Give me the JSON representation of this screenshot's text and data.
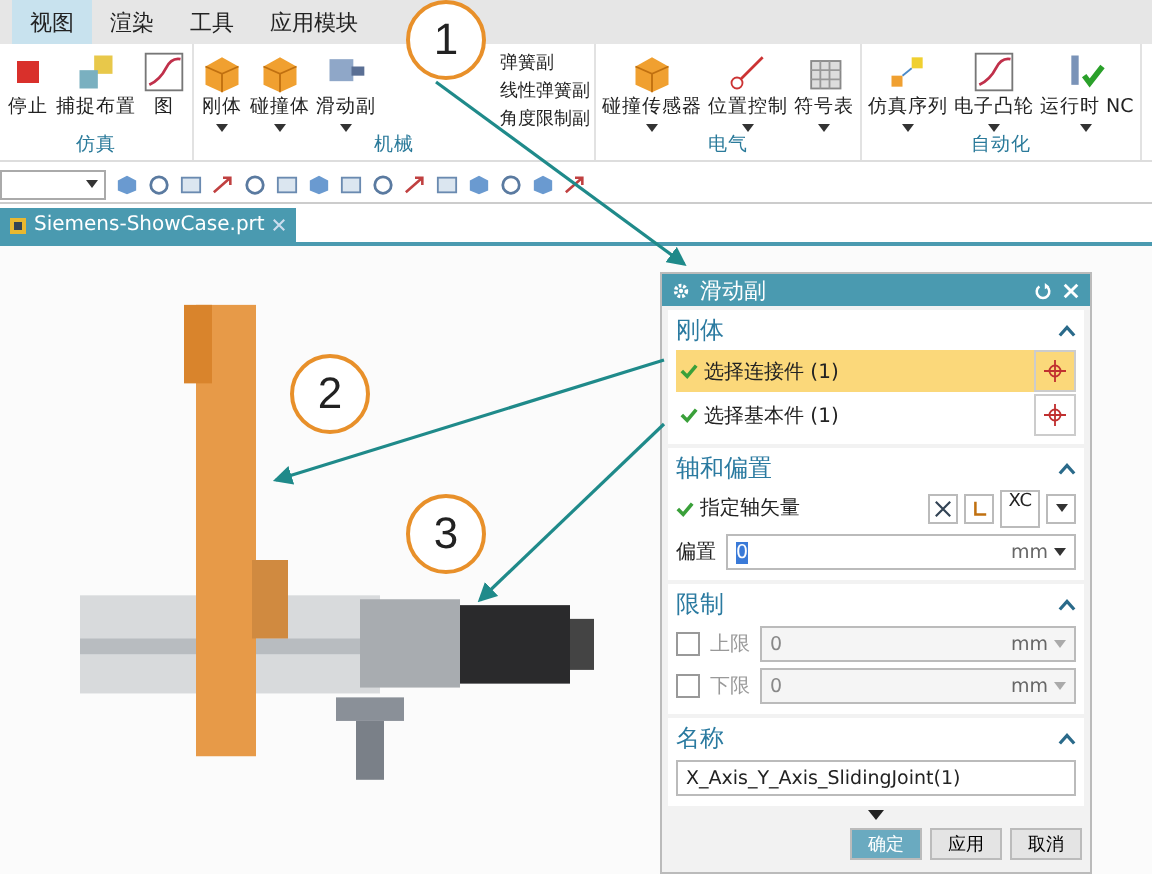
{
  "menu_tabs": [
    {
      "label": "视图",
      "selected": true
    },
    {
      "label": "渲染",
      "selected": false
    },
    {
      "label": "工具",
      "selected": false
    },
    {
      "label": "应用模块",
      "selected": false
    }
  ],
  "ribbon": {
    "groups": [
      {
        "label": "仿真",
        "buttons": [
          {
            "label": "停止",
            "has_menu": false
          },
          {
            "label": "捕捉布置",
            "has_menu": false
          },
          {
            "label": "图",
            "has_menu": false
          }
        ]
      },
      {
        "label": "机械",
        "buttons": [
          {
            "label": "刚体",
            "has_menu": true
          },
          {
            "label": "碰撞体",
            "has_menu": true
          },
          {
            "label": "滑动副",
            "has_menu": true
          }
        ],
        "small_items": [
          "弹簧副",
          "线性弹簧副",
          "角度限制副"
        ]
      },
      {
        "label": "电气",
        "buttons": [
          {
            "label": "碰撞传感器",
            "has_menu": true
          },
          {
            "label": "位置控制",
            "has_menu": true
          },
          {
            "label": "符号表",
            "has_menu": true
          }
        ]
      },
      {
        "label": "自动化",
        "buttons": [
          {
            "label": "仿真序列",
            "has_menu": true
          },
          {
            "label": "电子凸轮",
            "has_menu": true
          },
          {
            "label": "运行时 NC",
            "has_menu": true
          }
        ]
      }
    ]
  },
  "document_tabs": [
    {
      "label": "Siemens-ShowCase.prt",
      "selected": true
    }
  ],
  "callouts": [
    {
      "label": "1"
    },
    {
      "label": "2"
    },
    {
      "label": "3"
    }
  ],
  "dialog": {
    "title": "滑动副",
    "sections": [
      {
        "kind": "selection",
        "title": "刚体",
        "expanded": true,
        "rows": [
          {
            "label": "选择连接件 (1)",
            "done": true,
            "selected": true
          },
          {
            "label": "选择基本件 (1)",
            "done": true,
            "selected": false
          }
        ]
      },
      {
        "kind": "axis",
        "title": "轴和偏置",
        "expanded": true,
        "vector_label": "指定轴矢量",
        "vector_done": true,
        "vector_option": "XC",
        "offset_label": "偏置",
        "offset_value": "0",
        "offset_unit": "mm"
      },
      {
        "kind": "limits",
        "title": "限制",
        "expanded": true,
        "limits": [
          {
            "label": "上限",
            "checked": false,
            "value": "0",
            "unit": "mm"
          },
          {
            "label": "下限",
            "checked": false,
            "value": "0",
            "unit": "mm"
          }
        ]
      },
      {
        "kind": "name",
        "title": "名称",
        "expanded": true,
        "value": "X_Axis_Y_Axis_SlidingJoint(1)"
      }
    ],
    "buttons": [
      {
        "label": "确定",
        "primary": true
      },
      {
        "label": "应用",
        "primary": false
      },
      {
        "label": "取消",
        "primary": false
      }
    ]
  }
}
